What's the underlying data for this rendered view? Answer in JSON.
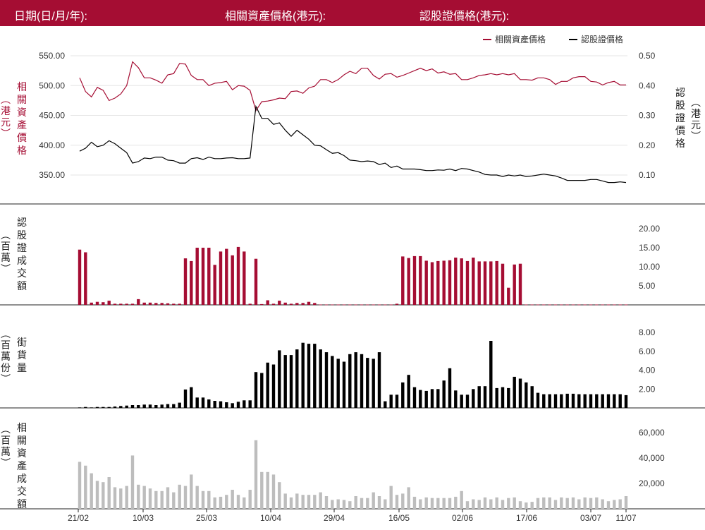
{
  "header": {
    "date_label": "日期(日/月/年):",
    "underlying_price_label": "相關資產價格(港元):",
    "warrant_price_label": "認股證價格(港元):"
  },
  "colors": {
    "brand": "#a50d33",
    "warrant_line": "#000000",
    "underlying_line": "#a50d33",
    "turnover_bar": "#a50d33",
    "street_bar": "#000000",
    "underlying_turnover_bar": "#bdbdbd"
  },
  "chart_data": [
    {
      "type": "line",
      "panel": "price",
      "legend_position": "top-right",
      "left_axis_title": "相關資產價格(港元)",
      "right_axis_title": "認股證價格(港元)",
      "left_ticks": [
        "550.00",
        "500.00",
        "450.00",
        "400.00",
        "350.00"
      ],
      "right_ticks": [
        "0.50",
        "0.40",
        "0.30",
        "0.20",
        "0.10"
      ],
      "left_ylim": [
        330,
        560
      ],
      "right_ylim": [
        0.05,
        0.515
      ],
      "series": [
        {
          "name": "相關資產價格",
          "axis": "left",
          "values": [
            513,
            490,
            481,
            497,
            492,
            475,
            479,
            486,
            500,
            540,
            530,
            513,
            513,
            509,
            504,
            518,
            520,
            537,
            536,
            517,
            510,
            510,
            500,
            504,
            505,
            507,
            493,
            500,
            499,
            492,
            458,
            473,
            474,
            476,
            479,
            478,
            490,
            491,
            487,
            496,
            499,
            510,
            510,
            505,
            510,
            518,
            524,
            520,
            529,
            529,
            517,
            511,
            519,
            520,
            514,
            517,
            521,
            525,
            529,
            525,
            528,
            521,
            523,
            519,
            520,
            510,
            510,
            513,
            517,
            518,
            520,
            518,
            520,
            518,
            520,
            510,
            510,
            509,
            513,
            513,
            510,
            502,
            507,
            507,
            513,
            515,
            515,
            507,
            506,
            501,
            505,
            507,
            501,
            501
          ]
        },
        {
          "name": "認股證價格",
          "axis": "right",
          "values": [
            0.18,
            0.19,
            0.21,
            0.195,
            0.2,
            0.215,
            0.205,
            0.19,
            0.175,
            0.14,
            0.145,
            0.157,
            0.155,
            0.16,
            0.16,
            0.15,
            0.148,
            0.14,
            0.14,
            0.155,
            0.158,
            0.152,
            0.16,
            0.155,
            0.155,
            0.157,
            0.158,
            0.155,
            0.155,
            0.157,
            0.33,
            0.29,
            0.29,
            0.27,
            0.275,
            0.25,
            0.23,
            0.25,
            0.235,
            0.22,
            0.2,
            0.198,
            0.185,
            0.173,
            0.175,
            0.165,
            0.15,
            0.148,
            0.145,
            0.147,
            0.145,
            0.135,
            0.14,
            0.125,
            0.13,
            0.12,
            0.12,
            0.12,
            0.118,
            0.115,
            0.115,
            0.117,
            0.116,
            0.12,
            0.115,
            0.122,
            0.12,
            0.115,
            0.11,
            0.102,
            0.1,
            0.1,
            0.095,
            0.1,
            0.097,
            0.1,
            0.095,
            0.097,
            0.1,
            0.103,
            0.1,
            0.097,
            0.09,
            0.082,
            0.082,
            0.082,
            0.082,
            0.085,
            0.085,
            0.08,
            0.075,
            0.075,
            0.077,
            0.075
          ]
        }
      ]
    },
    {
      "type": "bar",
      "panel": "warrant_turnover",
      "axis_title": "認股證成交額(百萬)",
      "ticks": [
        "20.00",
        "15.00",
        "10.00",
        "5.00"
      ],
      "ylim": [
        0,
        20
      ],
      "values": [
        14.5,
        13.8,
        0.6,
        0.8,
        0.7,
        1.1,
        0.3,
        0.3,
        0.3,
        0.3,
        1.5,
        0.6,
        0.6,
        0.5,
        0.5,
        0.4,
        0.3,
        0.3,
        12.2,
        11.5,
        15,
        15,
        15,
        10.5,
        14,
        14.7,
        13,
        15.2,
        14,
        0.3,
        12.1,
        0.2,
        1.2,
        0.3,
        1.1,
        0.6,
        0.3,
        0.5,
        0.5,
        0.8,
        0.5,
        0.1,
        0.1,
        0.1,
        0.1,
        0.1,
        0.1,
        0.1,
        0.1,
        0.1,
        0.1,
        0.1,
        0.1,
        0.1,
        0.3,
        12.7,
        12.3,
        12.8,
        12.8,
        11.6,
        11.2,
        11.5,
        11.6,
        11.7,
        12.4,
        12.2,
        11.5,
        12.4,
        11.4,
        11.4,
        11.4,
        11.5,
        10.8,
        4.5,
        10.6,
        10.8,
        0.1,
        0.1,
        0.1,
        0.1,
        0.1,
        0.1,
        0.1,
        0.1,
        0.1,
        0.1,
        0.1,
        0.1,
        0.1,
        0.1,
        0.1,
        0.1,
        0.1,
        0.1
      ]
    },
    {
      "type": "bar",
      "panel": "outstanding",
      "axis_title": "街貨量(百萬份)",
      "ticks": [
        "8.00",
        "6.00",
        "4.00",
        "2.00"
      ],
      "ylim": [
        0,
        8
      ],
      "values": [
        0.05,
        0.1,
        0.05,
        0.1,
        0.1,
        0.1,
        0.15,
        0.2,
        0.25,
        0.3,
        0.3,
        0.35,
        0.35,
        0.3,
        0.35,
        0.4,
        0.4,
        0.55,
        1.95,
        2.2,
        1.1,
        1.1,
        0.9,
        0.75,
        0.7,
        0.6,
        0.5,
        0.65,
        0.8,
        0.8,
        3.8,
        3.7,
        4.8,
        4.6,
        6.1,
        5.6,
        5.6,
        6.2,
        6.9,
        6.8,
        6.8,
        6.2,
        5.9,
        5.5,
        5.2,
        4.9,
        5.7,
        5.9,
        5.7,
        5.3,
        5.2,
        5.9,
        0.7,
        1.4,
        1.4,
        2.7,
        3.5,
        2.2,
        1.9,
        1.8,
        2.0,
        2.0,
        2.9,
        4.2,
        1.85,
        1.4,
        1.4,
        2.0,
        2.3,
        2.3,
        7.1,
        2.1,
        2.2,
        2.1,
        3.3,
        3.1,
        2.7,
        2.3,
        1.6,
        1.45,
        1.45,
        1.45,
        1.45,
        1.5,
        1.5,
        1.45,
        1.45,
        1.45,
        1.45,
        1.45,
        1.45,
        1.45,
        1.45,
        1.35
      ]
    },
    {
      "type": "bar",
      "panel": "underlying_turnover",
      "axis_title": "相關資產成交額(百萬)",
      "ticks": [
        "60,000",
        "40,000",
        "20,000"
      ],
      "ylim": [
        0,
        65000
      ],
      "values": [
        37000,
        34000,
        28000,
        22000,
        21000,
        25000,
        17000,
        16000,
        18000,
        42000,
        19000,
        18000,
        16000,
        14000,
        14000,
        17000,
        13000,
        19000,
        18000,
        27000,
        18000,
        14000,
        14000,
        9000,
        9500,
        11000,
        15000,
        11000,
        9000,
        15000,
        54000,
        29000,
        29000,
        27000,
        21000,
        12000,
        9000,
        12000,
        11000,
        11000,
        11000,
        13000,
        10000,
        7000,
        7500,
        7000,
        6000,
        10000,
        8500,
        8500,
        13000,
        10000,
        7500,
        18000,
        11000,
        12000,
        17000,
        9500,
        7500,
        9000,
        8500,
        8500,
        8500,
        8500,
        9500,
        14000,
        6000,
        7500,
        7000,
        9000,
        7500,
        9000,
        7000,
        8500,
        9000,
        6000,
        5000,
        5500,
        8500,
        9000,
        9000,
        7000,
        9000,
        8500,
        9000,
        7500,
        9000,
        8500,
        9000,
        7500,
        6000,
        7000,
        7500,
        10000
      ]
    }
  ],
  "x_axis": {
    "labels": [
      "21/02",
      "10/03",
      "25/03",
      "10/04",
      "29/04",
      "16/05",
      "02/06",
      "17/06",
      "03/07",
      "11/07"
    ]
  }
}
